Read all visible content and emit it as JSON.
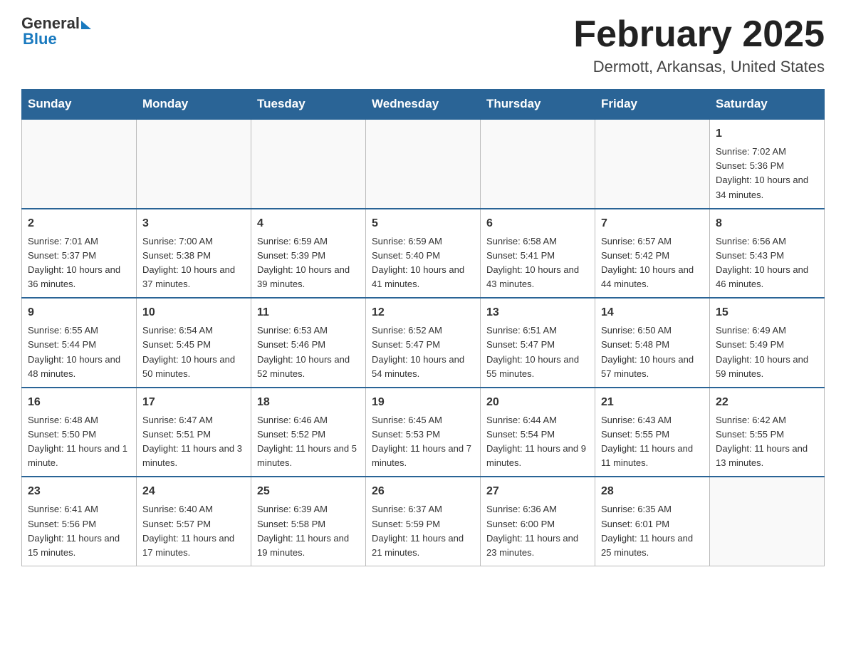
{
  "header": {
    "logo": {
      "general": "General",
      "blue": "Blue"
    },
    "title": "February 2025",
    "subtitle": "Dermott, Arkansas, United States"
  },
  "days_of_week": [
    "Sunday",
    "Monday",
    "Tuesday",
    "Wednesday",
    "Thursday",
    "Friday",
    "Saturday"
  ],
  "weeks": [
    [
      {
        "day": "",
        "sunrise": "",
        "sunset": "",
        "daylight": ""
      },
      {
        "day": "",
        "sunrise": "",
        "sunset": "",
        "daylight": ""
      },
      {
        "day": "",
        "sunrise": "",
        "sunset": "",
        "daylight": ""
      },
      {
        "day": "",
        "sunrise": "",
        "sunset": "",
        "daylight": ""
      },
      {
        "day": "",
        "sunrise": "",
        "sunset": "",
        "daylight": ""
      },
      {
        "day": "",
        "sunrise": "",
        "sunset": "",
        "daylight": ""
      },
      {
        "day": "1",
        "sunrise": "Sunrise: 7:02 AM",
        "sunset": "Sunset: 5:36 PM",
        "daylight": "Daylight: 10 hours and 34 minutes."
      }
    ],
    [
      {
        "day": "2",
        "sunrise": "Sunrise: 7:01 AM",
        "sunset": "Sunset: 5:37 PM",
        "daylight": "Daylight: 10 hours and 36 minutes."
      },
      {
        "day": "3",
        "sunrise": "Sunrise: 7:00 AM",
        "sunset": "Sunset: 5:38 PM",
        "daylight": "Daylight: 10 hours and 37 minutes."
      },
      {
        "day": "4",
        "sunrise": "Sunrise: 6:59 AM",
        "sunset": "Sunset: 5:39 PM",
        "daylight": "Daylight: 10 hours and 39 minutes."
      },
      {
        "day": "5",
        "sunrise": "Sunrise: 6:59 AM",
        "sunset": "Sunset: 5:40 PM",
        "daylight": "Daylight: 10 hours and 41 minutes."
      },
      {
        "day": "6",
        "sunrise": "Sunrise: 6:58 AM",
        "sunset": "Sunset: 5:41 PM",
        "daylight": "Daylight: 10 hours and 43 minutes."
      },
      {
        "day": "7",
        "sunrise": "Sunrise: 6:57 AM",
        "sunset": "Sunset: 5:42 PM",
        "daylight": "Daylight: 10 hours and 44 minutes."
      },
      {
        "day": "8",
        "sunrise": "Sunrise: 6:56 AM",
        "sunset": "Sunset: 5:43 PM",
        "daylight": "Daylight: 10 hours and 46 minutes."
      }
    ],
    [
      {
        "day": "9",
        "sunrise": "Sunrise: 6:55 AM",
        "sunset": "Sunset: 5:44 PM",
        "daylight": "Daylight: 10 hours and 48 minutes."
      },
      {
        "day": "10",
        "sunrise": "Sunrise: 6:54 AM",
        "sunset": "Sunset: 5:45 PM",
        "daylight": "Daylight: 10 hours and 50 minutes."
      },
      {
        "day": "11",
        "sunrise": "Sunrise: 6:53 AM",
        "sunset": "Sunset: 5:46 PM",
        "daylight": "Daylight: 10 hours and 52 minutes."
      },
      {
        "day": "12",
        "sunrise": "Sunrise: 6:52 AM",
        "sunset": "Sunset: 5:47 PM",
        "daylight": "Daylight: 10 hours and 54 minutes."
      },
      {
        "day": "13",
        "sunrise": "Sunrise: 6:51 AM",
        "sunset": "Sunset: 5:47 PM",
        "daylight": "Daylight: 10 hours and 55 minutes."
      },
      {
        "day": "14",
        "sunrise": "Sunrise: 6:50 AM",
        "sunset": "Sunset: 5:48 PM",
        "daylight": "Daylight: 10 hours and 57 minutes."
      },
      {
        "day": "15",
        "sunrise": "Sunrise: 6:49 AM",
        "sunset": "Sunset: 5:49 PM",
        "daylight": "Daylight: 10 hours and 59 minutes."
      }
    ],
    [
      {
        "day": "16",
        "sunrise": "Sunrise: 6:48 AM",
        "sunset": "Sunset: 5:50 PM",
        "daylight": "Daylight: 11 hours and 1 minute."
      },
      {
        "day": "17",
        "sunrise": "Sunrise: 6:47 AM",
        "sunset": "Sunset: 5:51 PM",
        "daylight": "Daylight: 11 hours and 3 minutes."
      },
      {
        "day": "18",
        "sunrise": "Sunrise: 6:46 AM",
        "sunset": "Sunset: 5:52 PM",
        "daylight": "Daylight: 11 hours and 5 minutes."
      },
      {
        "day": "19",
        "sunrise": "Sunrise: 6:45 AM",
        "sunset": "Sunset: 5:53 PM",
        "daylight": "Daylight: 11 hours and 7 minutes."
      },
      {
        "day": "20",
        "sunrise": "Sunrise: 6:44 AM",
        "sunset": "Sunset: 5:54 PM",
        "daylight": "Daylight: 11 hours and 9 minutes."
      },
      {
        "day": "21",
        "sunrise": "Sunrise: 6:43 AM",
        "sunset": "Sunset: 5:55 PM",
        "daylight": "Daylight: 11 hours and 11 minutes."
      },
      {
        "day": "22",
        "sunrise": "Sunrise: 6:42 AM",
        "sunset": "Sunset: 5:55 PM",
        "daylight": "Daylight: 11 hours and 13 minutes."
      }
    ],
    [
      {
        "day": "23",
        "sunrise": "Sunrise: 6:41 AM",
        "sunset": "Sunset: 5:56 PM",
        "daylight": "Daylight: 11 hours and 15 minutes."
      },
      {
        "day": "24",
        "sunrise": "Sunrise: 6:40 AM",
        "sunset": "Sunset: 5:57 PM",
        "daylight": "Daylight: 11 hours and 17 minutes."
      },
      {
        "day": "25",
        "sunrise": "Sunrise: 6:39 AM",
        "sunset": "Sunset: 5:58 PM",
        "daylight": "Daylight: 11 hours and 19 minutes."
      },
      {
        "day": "26",
        "sunrise": "Sunrise: 6:37 AM",
        "sunset": "Sunset: 5:59 PM",
        "daylight": "Daylight: 11 hours and 21 minutes."
      },
      {
        "day": "27",
        "sunrise": "Sunrise: 6:36 AM",
        "sunset": "Sunset: 6:00 PM",
        "daylight": "Daylight: 11 hours and 23 minutes."
      },
      {
        "day": "28",
        "sunrise": "Sunrise: 6:35 AM",
        "sunset": "Sunset: 6:01 PM",
        "daylight": "Daylight: 11 hours and 25 minutes."
      },
      {
        "day": "",
        "sunrise": "",
        "sunset": "",
        "daylight": ""
      }
    ]
  ]
}
